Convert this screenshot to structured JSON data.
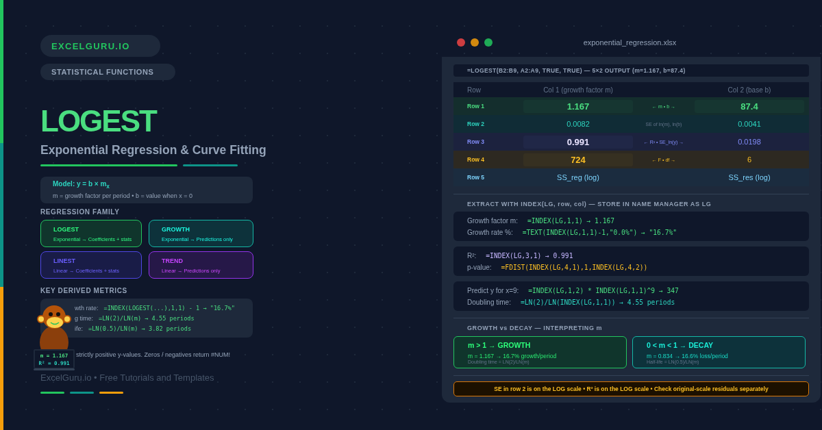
{
  "brand_badge": "EXCELGURU.IO",
  "category_badge": "STATISTICAL FUNCTIONS",
  "title": "LOGEST",
  "subtitle": "Exponential Regression & Curve Fitting",
  "model": {
    "formula": "Model: y = b × m$_{x}$",
    "description": "m = growth factor per period • b = value when x = 0"
  },
  "family": {
    "heading": "REGRESSION FAMILY",
    "items": [
      {
        "name": "LOGEST",
        "description": "Exponential → Coefficients + stats",
        "color": "#22c55e"
      },
      {
        "name": "GROWTH",
        "description": "Exponential → Predictions only",
        "color": "#14b8a6"
      },
      {
        "name": "LINEST",
        "description": "Linear → Coefficients + stats",
        "color": "#4f46e5"
      },
      {
        "name": "TREND",
        "description": "Linear → Predictions only",
        "color": "#9333ea"
      }
    ]
  },
  "metrics": {
    "heading": "KEY DERIVED METRICS",
    "rows": [
      {
        "label": "wth rate:",
        "formula": "=INDEX(LOGEST(...),1,1) - 1 → \"16.7%\""
      },
      {
        "label": "g time:",
        "formula": "=LN(2)/LN(m) → 4.55 periods"
      },
      {
        "label": "ife:",
        "formula": "=LN(0.5)/LN(m) → 3.82 periods"
      }
    ]
  },
  "mascot_screen": [
    "m = 1.167",
    "R² = 0.991"
  ],
  "note": "strictly positive y-values. Zeros / negatives return #NUM!",
  "footer": "ExcelGuru.io • Free Tutorials and Templates",
  "workbook": {
    "filename": "exponential_regression.xlsx",
    "formula_bar": "=LOGEST(B2:B9, A2:A9, TRUE, TRUE) — 5×2 OUTPUT (m=1.167, b=87.4)",
    "table": {
      "columns": [
        "Row",
        "Col 1 (growth factor m)",
        "Col 2 (base b)"
      ],
      "rows": [
        {
          "label": "Row 1",
          "color": "#4ade80",
          "col_1": {
            "text": "1.167",
            "highlighted": true
          },
          "note": "← m • b →",
          "col_2": {
            "text": "87.4",
            "highlighted": true
          }
        },
        {
          "label": "Row 2",
          "color": "#2dd4bf",
          "col_1": {
            "text": "0.0082",
            "highlighted": false
          },
          "note": "SE of ln(m), ln(b)",
          "col_2": {
            "text": "0.0041",
            "highlighted": false
          }
        },
        {
          "label": "Row 3",
          "color": "#818cf8",
          "col_1": {
            "text": "0.991",
            "highlighted": true
          },
          "note": "← R² • SE_ln(y) →",
          "col_2": {
            "text": "0.0198",
            "highlighted": false
          }
        },
        {
          "label": "Row 4",
          "color": "#fbbf24",
          "col_1": {
            "text": "724",
            "highlighted": true
          },
          "note": "← F • df →",
          "col_2": {
            "text": "6",
            "highlighted": false
          }
        },
        {
          "label": "Row 5",
          "color": "#7dd3fc",
          "col_1": {
            "text": "SS_reg (log)",
            "highlighted": false
          },
          "col_2": {
            "text": "SS_res (log)",
            "highlighted": false
          }
        }
      ]
    },
    "extract": {
      "heading": "EXTRACT WITH INDEX(LG, row, col) — STORE IN NAME MANAGER AS LG",
      "groups": [
        [
          {
            "label": "Growth factor m:",
            "formula": "=INDEX(LG,1,1) → 1.167",
            "color": "#4ade80"
          },
          {
            "label": "Growth rate %:",
            "formula": "=TEXT(INDEX(LG,1,1)-1,\"0.0%\") → \"16.7%\"",
            "color": "#4ade80"
          }
        ],
        [
          {
            "label": "R²:",
            "formula": "=INDEX(LG,3,1) → 0.991",
            "color": "#c4b5fd"
          },
          {
            "label": "p-value:",
            "formula": "=FDIST(INDEX(LG,4,1),1,INDEX(LG,4,2))",
            "color": "#fbbf24"
          }
        ],
        [
          {
            "label": "Predict y for x=9:",
            "formula": "=INDEX(LG,1,2) * INDEX(LG,1,1)^9 → 347",
            "color": "#4ade80"
          },
          {
            "label": "Doubling time:",
            "formula": "=LN(2)/LN(INDEX(LG,1,1)) → 4.55 periods",
            "color": "#2dd4bf"
          }
        ]
      ]
    },
    "interpret": {
      "heading": "GROWTH vs DECAY — INTERPRETING m",
      "cards": [
        {
          "title": "m > 1 → GROWTH",
          "detail": "m = 1.167 → 16.7% growth/period",
          "hint": "Doubling time = LN(2)/LN(m)",
          "color": "#22c55e"
        },
        {
          "title": "0 < m < 1 → DECAY",
          "detail": "m = 0.834 → 16.6% loss/period",
          "hint": "Half-life = LN(0.5)/LN(m)",
          "color": "#14b8a6"
        }
      ]
    },
    "warning": "SE in row 2 is on the LOG scale • R² is on the LOG scale • Check original-scale residuals separately"
  }
}
